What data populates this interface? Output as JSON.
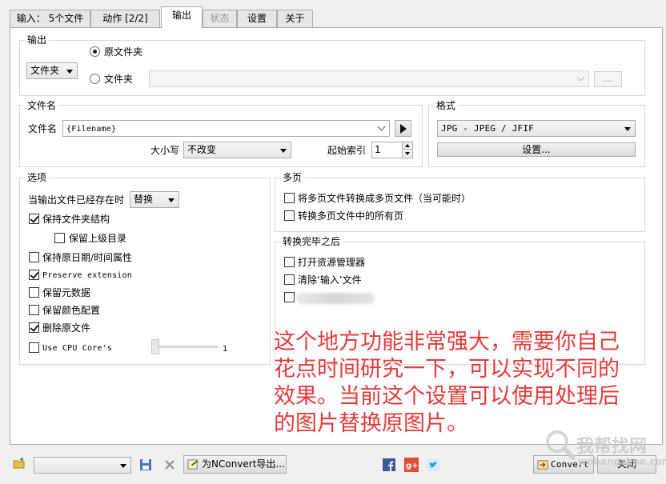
{
  "tabs": [
    {
      "label": "输入： 5个文件"
    },
    {
      "label": "动作 [2/2]"
    },
    {
      "label": "输出"
    },
    {
      "label": "状态"
    },
    {
      "label": "设置"
    },
    {
      "label": "关于"
    }
  ],
  "output_group": {
    "title": "输出",
    "destination_select": "文件夹",
    "radio_original": "原文件夹",
    "radio_folder": "文件夹",
    "folder_path": "",
    "browse_label": "..."
  },
  "filename_group": {
    "title": "文件名",
    "filename_label": "文件名",
    "filename_value": "{Filename}",
    "case_label": "大小写",
    "case_value": "不改变",
    "start_index_label": "起始索引",
    "start_index_value": "1"
  },
  "format_group": {
    "title": "格式",
    "format_value": "JPG - JPEG / JFIF",
    "settings_label": "设置..."
  },
  "options_group": {
    "title": "选项",
    "exists_label": "当输出文件已经存在时",
    "exists_value": "替换",
    "keep_structure": "保持文件夹结构",
    "keep_parent": "保留上级目录",
    "keep_date": "保持原日期/时间属性",
    "preserve_ext": "Preserve extension",
    "keep_meta": "保留元数据",
    "keep_color": "保留颜色配置",
    "delete_original": "删除原文件",
    "cpu_cores": "Use CPU Core's",
    "cpu_value": "1"
  },
  "multipage_group": {
    "title": "多页",
    "to_multipage": "将多页文件转换成多页文件（当可能时）",
    "convert_all": "转换多页文件中的所有页"
  },
  "after_group": {
    "title": "转换完毕之后",
    "open_explorer": "打开资源管理器",
    "clear_input": "清除‘输入’文件"
  },
  "annotation": [
    "这个地方功能非常强大，需要你自己",
    "花点时间研究一下，可以实现不同的",
    "效果。当前这个设置可以使用处理后",
    "的图片替换原图片。"
  ],
  "bottom": {
    "preset_value": "",
    "export_label": "为NConvert导出...",
    "convert_label": "Convert",
    "close_label": "关闭"
  },
  "watermark": {
    "line1": "我帮找网",
    "line2": "wobangzhao.com"
  },
  "colors": {
    "annotation": "#e33b3b",
    "facebook": "#3b5998",
    "google_plus": "#dd4b39",
    "twitter": "#1da1f2"
  }
}
